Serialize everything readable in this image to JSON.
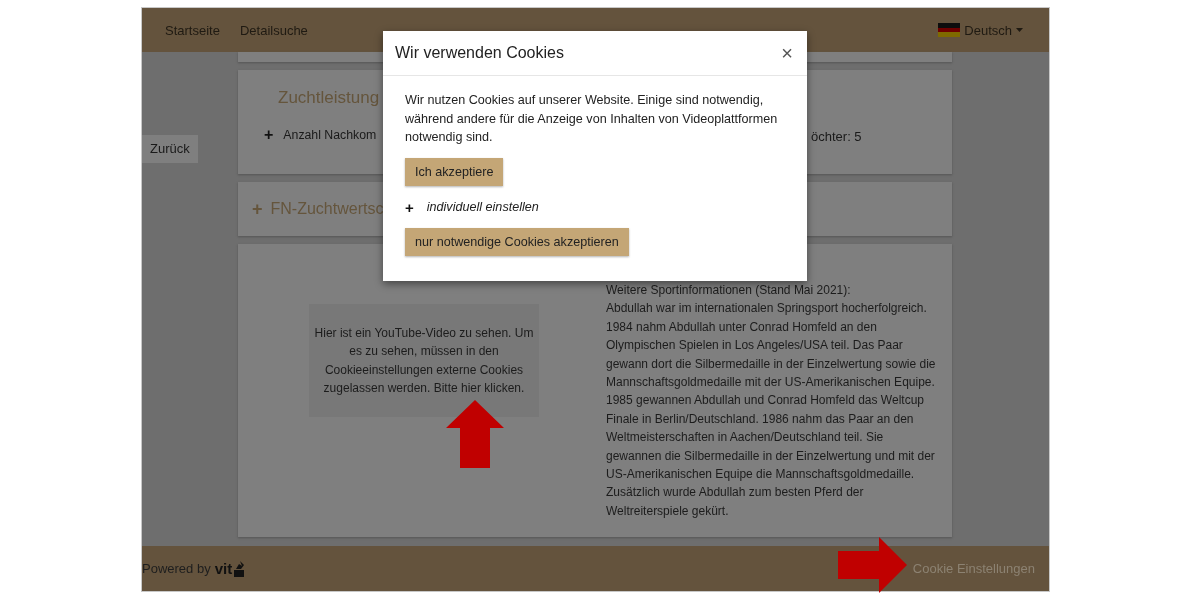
{
  "navbar": {
    "links": [
      {
        "label": "Startseite"
      },
      {
        "label": "Detailsuche"
      }
    ],
    "language": "Deutsch"
  },
  "back_button": "Zurück",
  "breeding_card": {
    "title": "Zuchtleistung",
    "toggle": "+",
    "item_left": "Anzahl Nachkom",
    "item_right": "öchter: 5"
  },
  "fn_card": {
    "toggle": "+",
    "title": "FN-Zuchtwertsc"
  },
  "video_notice": "Hier ist ein YouTube-Video zu sehen. Um es zu sehen, müssen in den Cookieeinstellungen externe Cookies zugelassen werden. Bitte hier klicken.",
  "sport_info": {
    "heading": "Weitere Sportinformationen (Stand Mai 2021):",
    "text": "Abdullah war im internationalen Springsport hocherfolgreich. 1984 nahm Abdullah unter Conrad Homfeld an den Olympischen Spielen in Los Angeles/USA teil. Das Paar gewann dort die Silbermedaille in der Einzelwertung sowie die Mannschaftsgoldmedaille mit der US-Amerikanischen Equipe. 1985 gewannen Abdullah und Conrad Homfeld das Weltcup Finale in Berlin/Deutschland. 1986 nahm das Paar an den Weltmeisterschaften in Aachen/Deutschland teil. Sie gewannen die Silbermedaille in der Einzelwertung und mit der US-Amerikanischen Equipe die Mannschaftsgoldmedaille. Zusätzlich wurde Abdullah zum besten Pferd der Weltreiterspiele gekürt."
  },
  "footer": {
    "powered_by": "Powered by",
    "logo": "vit",
    "cookie_settings": "Cookie Einstellungen"
  },
  "modal": {
    "title": "Wir verwenden Cookies",
    "close": "×",
    "text": "Wir nutzen Cookies auf unserer Website. Einige sind notwendig, während andere für die Anzeige von Inhalten von Videoplattformen notwendig sind.",
    "accept": "Ich akzeptiere",
    "custom_toggle": "+",
    "custom_label": "individuell einstellen",
    "necessary": "nur notwendige Cookies akzeptieren"
  }
}
